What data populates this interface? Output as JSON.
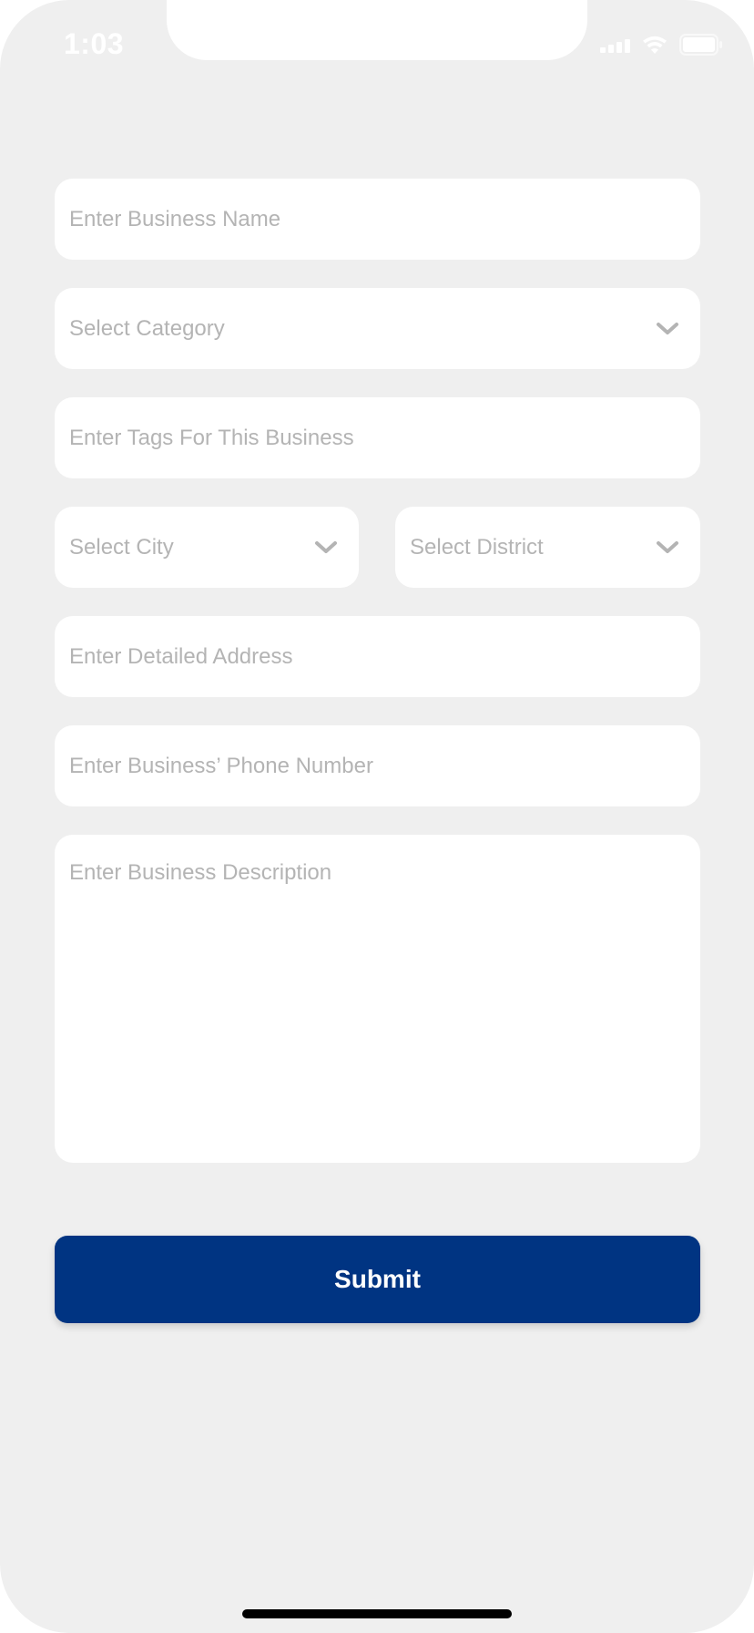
{
  "status_bar": {
    "time": "1:03"
  },
  "form": {
    "business_name": {
      "placeholder": "Enter Business Name"
    },
    "category": {
      "placeholder": "Select Category",
      "icon": "chevron-down-icon"
    },
    "tags": {
      "placeholder": "Enter Tags For This Business"
    },
    "city": {
      "placeholder": "Select City",
      "icon": "chevron-down-icon"
    },
    "district": {
      "placeholder": "Select District",
      "icon": "chevron-down-icon"
    },
    "address": {
      "placeholder": "Enter Detailed Address"
    },
    "phone": {
      "placeholder": "Enter Business’ Phone Number"
    },
    "description": {
      "placeholder": "Enter Business Description"
    }
  },
  "submit": {
    "label": "Submit"
  },
  "colors": {
    "background": "#efefef",
    "field_background": "#ffffff",
    "placeholder_text": "#b4b4b4",
    "primary_button": "#003482",
    "button_text": "#ffffff"
  }
}
